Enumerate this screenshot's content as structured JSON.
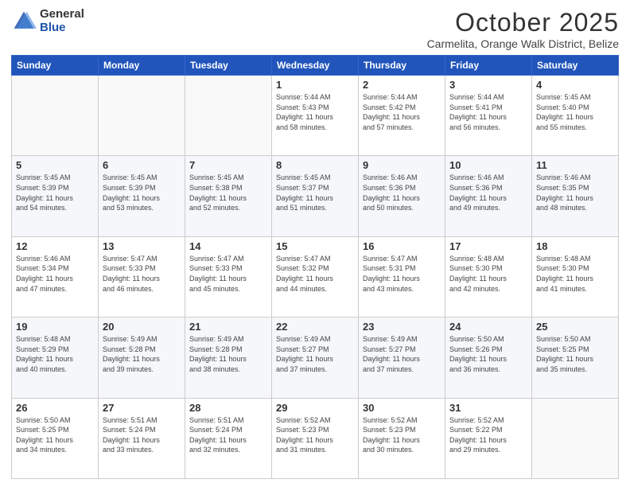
{
  "logo": {
    "general": "General",
    "blue": "Blue"
  },
  "header": {
    "month": "October 2025",
    "location": "Carmelita, Orange Walk District, Belize"
  },
  "days_of_week": [
    "Sunday",
    "Monday",
    "Tuesday",
    "Wednesday",
    "Thursday",
    "Friday",
    "Saturday"
  ],
  "weeks": [
    [
      {
        "day": "",
        "info": ""
      },
      {
        "day": "",
        "info": ""
      },
      {
        "day": "",
        "info": ""
      },
      {
        "day": "1",
        "info": "Sunrise: 5:44 AM\nSunset: 5:43 PM\nDaylight: 11 hours\nand 58 minutes."
      },
      {
        "day": "2",
        "info": "Sunrise: 5:44 AM\nSunset: 5:42 PM\nDaylight: 11 hours\nand 57 minutes."
      },
      {
        "day": "3",
        "info": "Sunrise: 5:44 AM\nSunset: 5:41 PM\nDaylight: 11 hours\nand 56 minutes."
      },
      {
        "day": "4",
        "info": "Sunrise: 5:45 AM\nSunset: 5:40 PM\nDaylight: 11 hours\nand 55 minutes."
      }
    ],
    [
      {
        "day": "5",
        "info": "Sunrise: 5:45 AM\nSunset: 5:39 PM\nDaylight: 11 hours\nand 54 minutes."
      },
      {
        "day": "6",
        "info": "Sunrise: 5:45 AM\nSunset: 5:39 PM\nDaylight: 11 hours\nand 53 minutes."
      },
      {
        "day": "7",
        "info": "Sunrise: 5:45 AM\nSunset: 5:38 PM\nDaylight: 11 hours\nand 52 minutes."
      },
      {
        "day": "8",
        "info": "Sunrise: 5:45 AM\nSunset: 5:37 PM\nDaylight: 11 hours\nand 51 minutes."
      },
      {
        "day": "9",
        "info": "Sunrise: 5:46 AM\nSunset: 5:36 PM\nDaylight: 11 hours\nand 50 minutes."
      },
      {
        "day": "10",
        "info": "Sunrise: 5:46 AM\nSunset: 5:36 PM\nDaylight: 11 hours\nand 49 minutes."
      },
      {
        "day": "11",
        "info": "Sunrise: 5:46 AM\nSunset: 5:35 PM\nDaylight: 11 hours\nand 48 minutes."
      }
    ],
    [
      {
        "day": "12",
        "info": "Sunrise: 5:46 AM\nSunset: 5:34 PM\nDaylight: 11 hours\nand 47 minutes."
      },
      {
        "day": "13",
        "info": "Sunrise: 5:47 AM\nSunset: 5:33 PM\nDaylight: 11 hours\nand 46 minutes."
      },
      {
        "day": "14",
        "info": "Sunrise: 5:47 AM\nSunset: 5:33 PM\nDaylight: 11 hours\nand 45 minutes."
      },
      {
        "day": "15",
        "info": "Sunrise: 5:47 AM\nSunset: 5:32 PM\nDaylight: 11 hours\nand 44 minutes."
      },
      {
        "day": "16",
        "info": "Sunrise: 5:47 AM\nSunset: 5:31 PM\nDaylight: 11 hours\nand 43 minutes."
      },
      {
        "day": "17",
        "info": "Sunrise: 5:48 AM\nSunset: 5:30 PM\nDaylight: 11 hours\nand 42 minutes."
      },
      {
        "day": "18",
        "info": "Sunrise: 5:48 AM\nSunset: 5:30 PM\nDaylight: 11 hours\nand 41 minutes."
      }
    ],
    [
      {
        "day": "19",
        "info": "Sunrise: 5:48 AM\nSunset: 5:29 PM\nDaylight: 11 hours\nand 40 minutes."
      },
      {
        "day": "20",
        "info": "Sunrise: 5:49 AM\nSunset: 5:28 PM\nDaylight: 11 hours\nand 39 minutes."
      },
      {
        "day": "21",
        "info": "Sunrise: 5:49 AM\nSunset: 5:28 PM\nDaylight: 11 hours\nand 38 minutes."
      },
      {
        "day": "22",
        "info": "Sunrise: 5:49 AM\nSunset: 5:27 PM\nDaylight: 11 hours\nand 37 minutes."
      },
      {
        "day": "23",
        "info": "Sunrise: 5:49 AM\nSunset: 5:27 PM\nDaylight: 11 hours\nand 37 minutes."
      },
      {
        "day": "24",
        "info": "Sunrise: 5:50 AM\nSunset: 5:26 PM\nDaylight: 11 hours\nand 36 minutes."
      },
      {
        "day": "25",
        "info": "Sunrise: 5:50 AM\nSunset: 5:25 PM\nDaylight: 11 hours\nand 35 minutes."
      }
    ],
    [
      {
        "day": "26",
        "info": "Sunrise: 5:50 AM\nSunset: 5:25 PM\nDaylight: 11 hours\nand 34 minutes."
      },
      {
        "day": "27",
        "info": "Sunrise: 5:51 AM\nSunset: 5:24 PM\nDaylight: 11 hours\nand 33 minutes."
      },
      {
        "day": "28",
        "info": "Sunrise: 5:51 AM\nSunset: 5:24 PM\nDaylight: 11 hours\nand 32 minutes."
      },
      {
        "day": "29",
        "info": "Sunrise: 5:52 AM\nSunset: 5:23 PM\nDaylight: 11 hours\nand 31 minutes."
      },
      {
        "day": "30",
        "info": "Sunrise: 5:52 AM\nSunset: 5:23 PM\nDaylight: 11 hours\nand 30 minutes."
      },
      {
        "day": "31",
        "info": "Sunrise: 5:52 AM\nSunset: 5:22 PM\nDaylight: 11 hours\nand 29 minutes."
      },
      {
        "day": "",
        "info": ""
      }
    ]
  ]
}
